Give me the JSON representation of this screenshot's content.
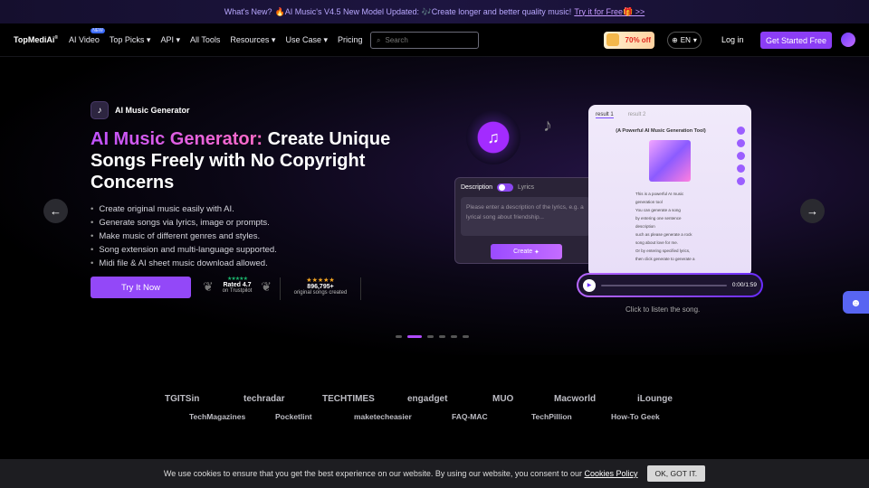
{
  "banner": {
    "prefix": "What's New?",
    "message": "🔥AI Music's V4.5 New Model Updated: 🎶Create longer and better quality music!",
    "link": "Try it for Free🎁 >>"
  },
  "nav": {
    "logo": "TopMediAi",
    "logo_mark": "®",
    "items": [
      "AI Video",
      "Top Picks",
      "API",
      "All Tools",
      "Resources",
      "Use Case",
      "Pricing"
    ],
    "new_badge": "NEW",
    "search_placeholder": "Search",
    "promo": "70% off",
    "lang": "EN",
    "login": "Log in",
    "cta": "Get Started Free"
  },
  "hero": {
    "tag": "AI Music Generator",
    "title_accent": "AI Music Generator:",
    "title_rest": " Create Unique Songs Freely with No Copyright Concerns",
    "bullets": [
      "Create original music easily with AI.",
      "Generate songs via lyrics, image or prompts.",
      "Make music of different genres and styles.",
      "Song extension and multi-language supported.",
      "Midi file & AI sheet music download allowed."
    ],
    "cta": "Try It Now",
    "trustpilot": {
      "rating": "Rated 4.7",
      "sub": "on Trustpilot"
    },
    "count": {
      "value": "896,795+",
      "sub": "original songs created"
    }
  },
  "demo": {
    "tab1": "Description",
    "tab2": "Lyrics",
    "placeholder": "Please enter a description of the lyrics, e.g. a lyrical song about friendship...",
    "create": "Create",
    "result1": "result 1",
    "result2": "result 2",
    "song_title": "(A Powerful AI Music Generation Tool)",
    "lyrics": [
      "This is a powerful AI music",
      "generation tool",
      "You can generate a song",
      "by entering one sentence",
      "description",
      "such as please generate a rock",
      "song about love for me.",
      "Or by entering specified lyrics,",
      "then click generate to generate a"
    ],
    "time": "0:00/1:59",
    "caption": "Click to listen the song."
  },
  "logos": {
    "row1": [
      "TGITSin",
      "techradar",
      "TECHTIMES",
      "engadget",
      "MUO",
      "Macworld",
      "iLounge"
    ],
    "row2": [
      "TechMagazines",
      "Pocketlint",
      "maketecheasier",
      "FAQ-MAC",
      "TechPillion",
      "How-To Geek"
    ]
  },
  "cookie": {
    "text": "We use cookies to ensure that you get the best experience on our website. By using our website, you consent to our",
    "link": "Cookies Policy",
    "button": "OK, GOT IT."
  }
}
